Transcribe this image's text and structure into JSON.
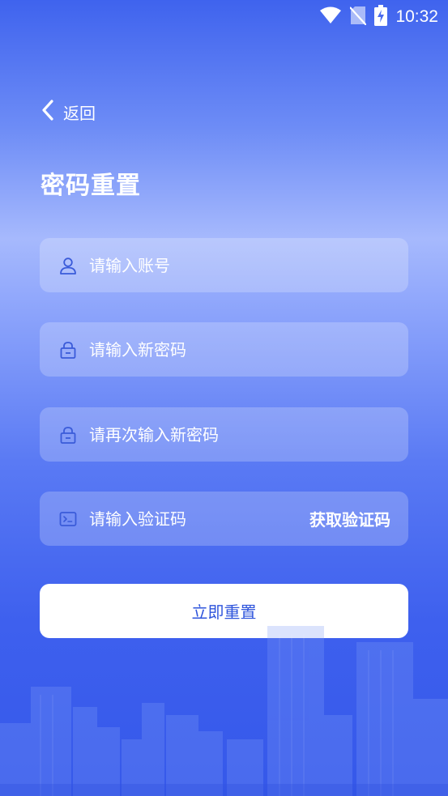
{
  "status_bar": {
    "time": "10:32",
    "icons": [
      "wifi-icon",
      "no-sim-icon",
      "battery-charging-icon"
    ]
  },
  "nav": {
    "back_label": "返回"
  },
  "page": {
    "title": "密码重置"
  },
  "form": {
    "account": {
      "placeholder": "请输入账号",
      "icon": "user-icon"
    },
    "new_password": {
      "placeholder": "请输入新密码",
      "icon": "lock-icon"
    },
    "confirm_password": {
      "placeholder": "请再次输入新密码",
      "icon": "lock-icon"
    },
    "code": {
      "placeholder": "请输入验证码",
      "icon": "terminal-icon",
      "get_code_label": "获取验证码"
    },
    "submit_label": "立即重置"
  },
  "colors": {
    "accent": "#2f55dc",
    "icon": "#3a5bd9",
    "background_top": "#3f63ee",
    "background_mid": "#a6b9fd",
    "background_bottom": "#3558ea"
  }
}
